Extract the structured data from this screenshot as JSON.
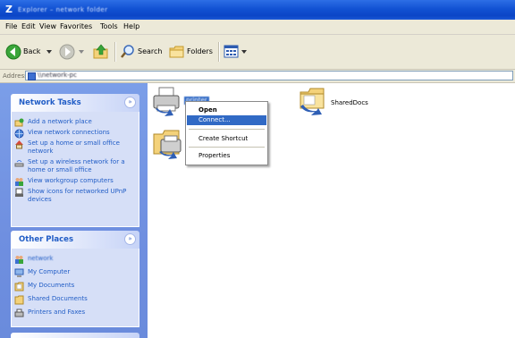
{
  "window": {
    "title": "Explorer – network folder",
    "app_icon": "Z"
  },
  "menu": [
    "File",
    "Edit",
    "View",
    "Favorites",
    "Tools",
    "Help"
  ],
  "toolbar": {
    "back_label": "Back",
    "search_label": "Search",
    "folders_label": "Folders"
  },
  "address": {
    "label": "Address",
    "value": "\\\\network-pc"
  },
  "network_tasks": {
    "title": "Network Tasks",
    "collapse_glyph": "»",
    "items": [
      "Add a network place",
      "View network connections",
      "Set up a home or small office network",
      "Set up a wireless network for a home or small office",
      "View workgroup computers",
      "Show icons for networked UPnP devices"
    ]
  },
  "other_places": {
    "title": "Other Places",
    "collapse_glyph": "»",
    "items": [
      "network",
      "My Computer",
      "My Documents",
      "Shared Documents",
      "Printers and Faxes"
    ]
  },
  "content": {
    "items": [
      {
        "label": "printer",
        "icon": "shared-printer-icon"
      },
      {
        "label": "SharedDocs",
        "icon": "shared-folder-icon"
      },
      {
        "label": "",
        "icon": "printers-folder-icon"
      }
    ]
  },
  "context_menu": {
    "items": [
      "Open",
      "Connect...",
      "Create Shortcut",
      "Properties"
    ],
    "selected": "Connect..."
  },
  "colors": {
    "titlebar": "#0b45c6",
    "task_pane": "#6f8fe0",
    "link": "#215dc6",
    "selection": "#316ac5"
  }
}
